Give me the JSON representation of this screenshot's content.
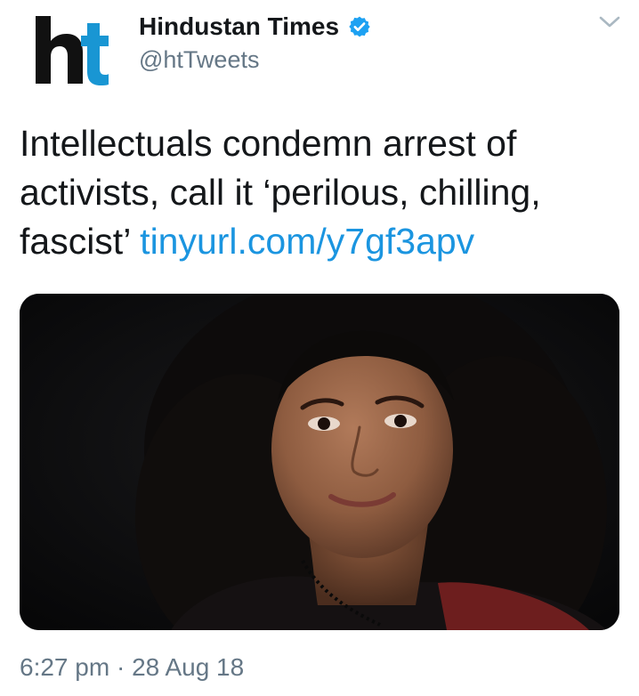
{
  "account": {
    "display_name": "Hindustan Times",
    "handle": "@htTweets",
    "avatar_text": "ht",
    "verified": true
  },
  "tweet": {
    "text": "Intellectuals condemn arrest of activists, call it ‘perilous, chilling, fascist’ ",
    "link": "tinyurl.com/y7gf3apv",
    "time": "6:27 pm",
    "separator": "·",
    "date": "28 Aug 18"
  },
  "media": {
    "description_icon": "photo-of-woman"
  },
  "colors": {
    "link": "#1b95e0",
    "secondary_text": "#657786",
    "verified": "#1da1f2",
    "brand_h": "#111111",
    "brand_t": "#1996d3"
  },
  "icons": {
    "verified": "verified-badge-icon",
    "menu": "chevron-down-icon"
  }
}
